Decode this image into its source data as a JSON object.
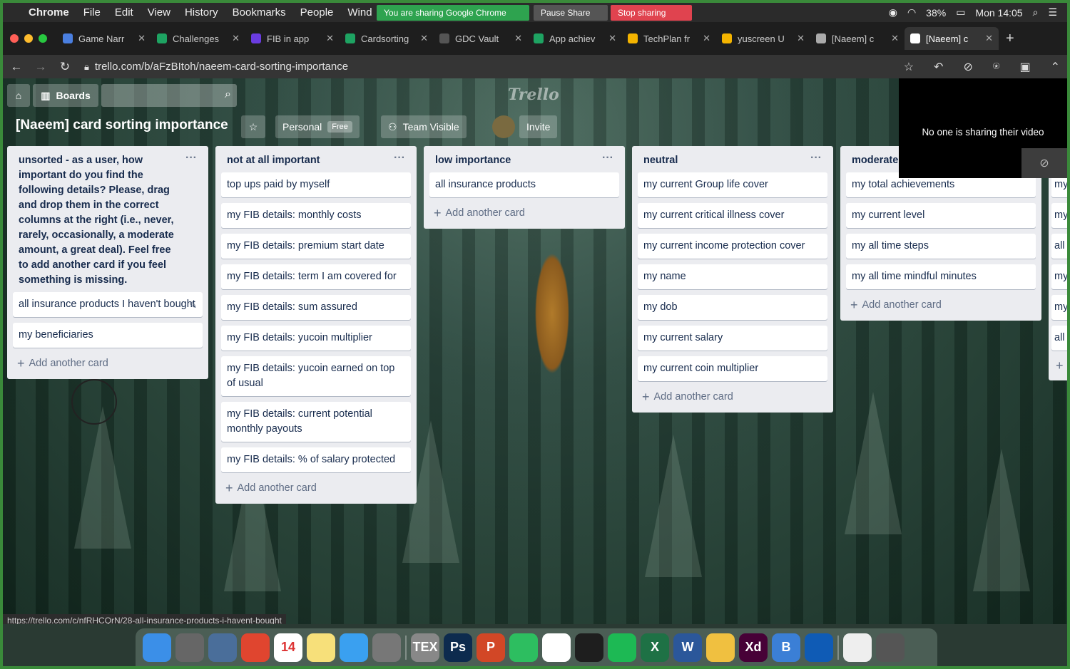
{
  "menubar": {
    "app": "Chrome",
    "items": [
      "File",
      "Edit",
      "View",
      "History",
      "Bookmarks",
      "People",
      "Wind"
    ],
    "sharing_notice": "You are sharing Google Chrome",
    "pause_share": "Pause Share",
    "stop_sharing": "Stop sharing",
    "battery": "38%",
    "clock": "Mon 14:05"
  },
  "tabs": [
    {
      "label": "Game Narr",
      "color": "#4a7fe0"
    },
    {
      "label": "Challenges",
      "color": "#1ea362"
    },
    {
      "label": "FIB in app",
      "color": "#6a3ce0"
    },
    {
      "label": "Cardsorting",
      "color": "#1ea362"
    },
    {
      "label": "GDC Vault",
      "color": "#555555"
    },
    {
      "label": "App achiev",
      "color": "#1ea362"
    },
    {
      "label": "TechPlan fr",
      "color": "#f4b400"
    },
    {
      "label": "yuscreen U",
      "color": "#f4b400"
    },
    {
      "label": "[Naeem] c",
      "color": "#aaaaaa"
    },
    {
      "label": "[Naeem] c",
      "color": "#ffffff"
    }
  ],
  "url": "trello.com/b/aFzBItoh/naeem-card-sorting-importance",
  "board": {
    "boards_label": "Boards",
    "logo": "Trello",
    "title": "[Naeem] card sorting importance",
    "workspace": "Personal",
    "plan": "Free",
    "visibility": "Team Visible",
    "invite": "Invite"
  },
  "video_notice": "No one is sharing their video",
  "lists": [
    {
      "title": "unsorted - as a user, how important do you find the following details? Please, drag and drop them in the correct columns at the right (i.e., never, rarely, occasionally, a moderate amount, a great deal). Feel free to add another card if you feel something is missing.",
      "cards": [
        "all insurance products I haven't bought",
        "my beneficiaries"
      ],
      "add": "Add another card"
    },
    {
      "title": "not at all important",
      "cards": [
        "top ups paid by myself",
        "my FIB details: monthly costs",
        "my FIB details: premium start date",
        "my FIB details: term I am covered for",
        "my FIB details: sum assured",
        "my FIB details: yucoin multiplier",
        "my FIB details: yucoin earned on top of usual",
        "my FIB details: current potential monthly payouts",
        "my FIB details: % of salary protected"
      ],
      "add": "Add another card"
    },
    {
      "title": "low importance",
      "cards": [
        "all insurance products"
      ],
      "add": "Add another card"
    },
    {
      "title": "neutral",
      "cards": [
        "my current Group life cover",
        "my current critical illness cover",
        "my current income protection cover",
        "my name",
        "my dob",
        "my current salary",
        "my current coin multiplier"
      ],
      "add": "Add another card"
    },
    {
      "title": "moderate",
      "cards": [
        "my total achievements",
        "my current level",
        "my all time steps",
        "my all time mindful minutes"
      ],
      "add": "Add another card"
    }
  ],
  "partial_list_cards": [
    "my",
    "my",
    "all",
    "my",
    "my so",
    "all"
  ],
  "status_url": "https://trello.com/c/nfRHCQrN/28-all-insurance-products-i-havent-bought",
  "dock": [
    {
      "name": "Finder",
      "color": "#3b8fe8",
      "glyph": ""
    },
    {
      "name": "Launchpad",
      "color": "#666666",
      "glyph": ""
    },
    {
      "name": "Preview",
      "color": "#4a6e9a",
      "glyph": ""
    },
    {
      "name": "Chrome",
      "color": "#e0452f",
      "glyph": ""
    },
    {
      "name": "Calendar",
      "color": "#ffffff",
      "glyph": "14"
    },
    {
      "name": "Notes",
      "color": "#f7e07a",
      "glyph": ""
    },
    {
      "name": "Messages",
      "color": "#3aa0f0",
      "glyph": ""
    },
    {
      "name": "System Preferences",
      "color": "#777777",
      "glyph": ""
    },
    {
      "name": "TeX",
      "color": "#888888",
      "glyph": "TEX"
    },
    {
      "name": "Photoshop",
      "color": "#0d2b4e",
      "glyph": "Ps"
    },
    {
      "name": "PowerPoint",
      "color": "#d24726",
      "glyph": "P"
    },
    {
      "name": "Evernote",
      "color": "#2dbe60",
      "glyph": ""
    },
    {
      "name": "Slack",
      "color": "#ffffff",
      "glyph": ""
    },
    {
      "name": "Figma",
      "color": "#1e1e1e",
      "glyph": ""
    },
    {
      "name": "Spotify",
      "color": "#1db954",
      "glyph": ""
    },
    {
      "name": "Excel",
      "color": "#1e7145",
      "glyph": "X"
    },
    {
      "name": "Word",
      "color": "#2b579a",
      "glyph": "W"
    },
    {
      "name": "Mail",
      "color": "#f0c040",
      "glyph": ""
    },
    {
      "name": "Adobe XD",
      "color": "#470137",
      "glyph": "Xd"
    },
    {
      "name": "Bootstrap Studio",
      "color": "#3b7fd6",
      "glyph": "B"
    },
    {
      "name": "Edge",
      "color": "#0f5bb5",
      "glyph": ""
    },
    {
      "name": "Preview Files",
      "color": "#eeeeee",
      "glyph": ""
    },
    {
      "name": "Trash",
      "color": "#555555",
      "glyph": ""
    }
  ]
}
